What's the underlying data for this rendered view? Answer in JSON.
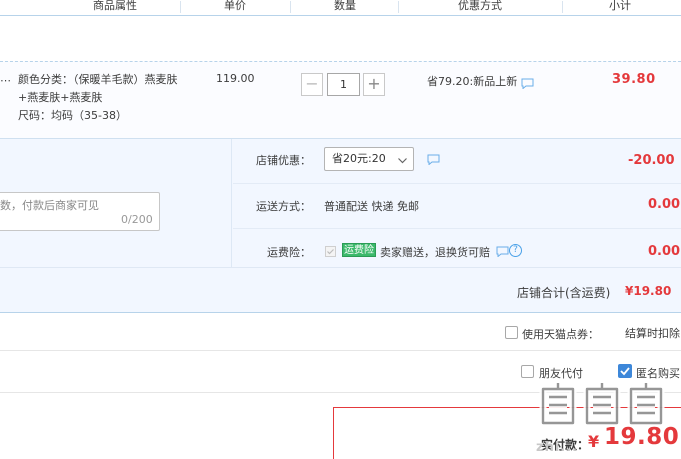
{
  "header": {
    "columns": [
      "商品属性",
      "单价",
      "数量",
      "优惠方式",
      "小计"
    ]
  },
  "item": {
    "attr_line1": "颜色分类：（保暖羊毛款）燕麦肤",
    "attr_line2": "+燕麦肤+燕麦肤",
    "attr_line3": "尺码：均码（35-38）",
    "price": "119.00",
    "qty_minus": "−",
    "qty_value": "1",
    "qty_plus": "+",
    "promo": "省79.20:新品上新",
    "subtotal": "39.80",
    "chat_icon": "chat-bubble-icon"
  },
  "shop": {
    "memo_placeholder": "数，付款后商家可见",
    "memo_count": "0/200",
    "coupon_label": "店铺优惠：",
    "coupon_selected": "省20元:20",
    "coupon_value": "-20.00",
    "shipping_label": "运送方式：",
    "shipping_value": "普通配送 快递 免邮",
    "shipping_amount": "0.00",
    "insurance_label": "运费险：",
    "insurance_tag": "运费险",
    "insurance_text": "卖家赠送，退换货可赔",
    "insurance_help": "?",
    "insurance_amount": "0.00",
    "total_label": "店铺合计(含运费)",
    "total_value": "¥19.80"
  },
  "options": {
    "tmall_coupon_label": "使用天猫点券：",
    "tmall_coupon_note": "结算时扣除",
    "friend_pay_label": "朋友代付",
    "anonymous_label": "匿名购买",
    "anonymous_checked": true
  },
  "pay": {
    "label": "实付款：",
    "currency": "¥",
    "value": "19.80"
  },
  "watermark": {
    "text": "值值值",
    "url": "zhi..."
  },
  "colors": {
    "price_red": "#e4393c",
    "border_blue": "#b7d3ea",
    "panel_bg": "#f2f7ff",
    "check_blue": "#3d87d9",
    "tag_green": "#3cb96b"
  }
}
